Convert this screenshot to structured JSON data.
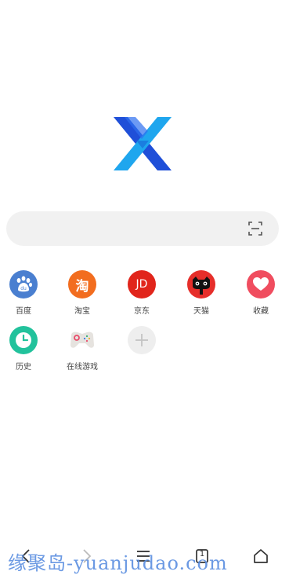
{
  "search": {
    "placeholder": ""
  },
  "shortcuts": [
    {
      "label": "百度",
      "icon": "baidu-paw-icon",
      "color": "#4a7fd0",
      "glyph": "du"
    },
    {
      "label": "淘宝",
      "icon": "taobao-icon",
      "color": "#f26d1f",
      "glyph": "淘"
    },
    {
      "label": "京东",
      "icon": "jd-icon",
      "color": "#e1251b",
      "glyph": "JD"
    },
    {
      "label": "天猫",
      "icon": "tmall-cat-icon",
      "color": "#e62e2a",
      "glyph": ""
    },
    {
      "label": "收藏",
      "icon": "heart-icon",
      "color": "#f04d5f",
      "glyph": ""
    },
    {
      "label": "历史",
      "icon": "clock-icon",
      "color": "#22c29c",
      "glyph": ""
    },
    {
      "label": "在线游戏",
      "icon": "gamepad-icon",
      "color": "#eeeeee",
      "glyph": ""
    },
    {
      "label": "",
      "icon": "add-icon",
      "color": "#eeeeee",
      "glyph": ""
    }
  ],
  "bottom_nav": [
    {
      "name": "back",
      "icon": "chevron-left-icon"
    },
    {
      "name": "forward",
      "icon": "chevron-right-icon"
    },
    {
      "name": "menu",
      "icon": "menu-icon"
    },
    {
      "name": "tabs",
      "icon": "tabs-icon",
      "count": "1"
    },
    {
      "name": "home",
      "icon": "home-icon"
    }
  ],
  "watermark": "缘聚岛-yuanjudao.com",
  "colors": {
    "logo_dark": "#1f4fd8",
    "logo_light": "#1fa6ee",
    "search_bg": "#f1f1f1",
    "watermark": "#5b8fe0"
  }
}
